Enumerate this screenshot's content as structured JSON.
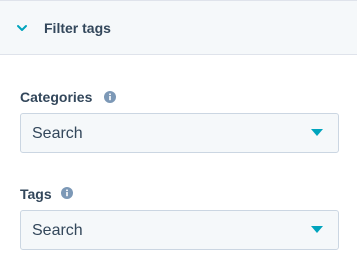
{
  "header": {
    "title": "Filter tags",
    "chevron_icon": "chevron-down-icon"
  },
  "categories": {
    "label": "Categories",
    "info_icon": "info-icon",
    "select_value": "Search"
  },
  "tags": {
    "label": "Tags",
    "info_icon": "info-icon",
    "select_value": "Search"
  },
  "colors": {
    "accent": "#00a4bd",
    "text": "#33475b",
    "icon_gray": "#7c98b6",
    "input_bg": "#f5f8fa",
    "input_border": "#cbd6e2"
  }
}
